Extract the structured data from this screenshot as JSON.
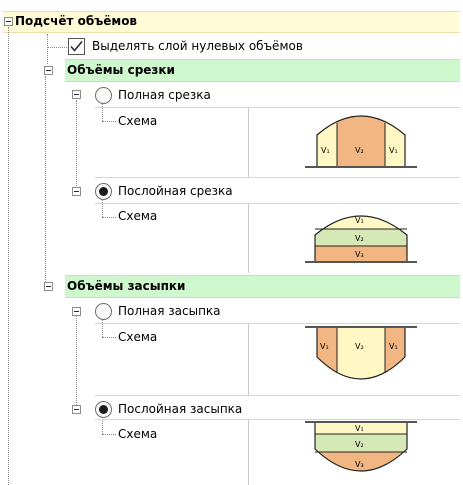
{
  "section": {
    "title": "Подсчёт объёмов",
    "checkbox_label": "Выделять слой нулевых объёмов",
    "checkbox_checked": true
  },
  "cut": {
    "title": "Объёмы срезки",
    "full_label": "Полная срезка",
    "full_scheme_label": "Схема",
    "layer_label": "Послойная срезка",
    "layer_scheme_label": "Схема",
    "selected": "layer"
  },
  "fill": {
    "title": "Объёмы засыпки",
    "full_label": "Полная засыпка",
    "full_scheme_label": "Схема",
    "layer_label": "Послойная засыпка",
    "layer_scheme_label": "Схема",
    "selected": "layer"
  },
  "scheme": {
    "v1": "V₁",
    "v2": "V₂",
    "v3": "V₃",
    "colors": {
      "v1": "#fff8c4",
      "v2": "#f2b682",
      "v3": "#f2b682",
      "layer2": "#d6e8b6"
    }
  }
}
